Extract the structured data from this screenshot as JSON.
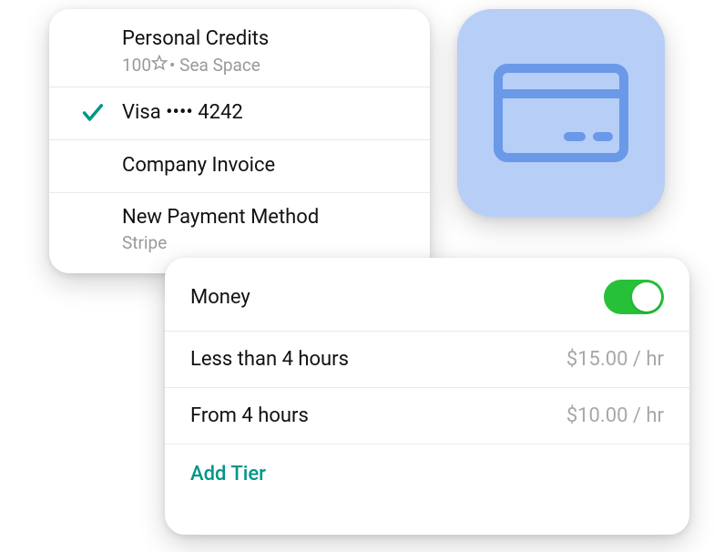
{
  "payments": {
    "items": [
      {
        "title": "Personal Credits",
        "sub_prefix": "100",
        "sub_suffix": " • Sea Space",
        "selected": false
      },
      {
        "title": "Visa •••• 4242",
        "selected": true
      },
      {
        "title": "Company Invoice",
        "selected": false
      },
      {
        "title": "New Payment Method",
        "sub_plain": "Stripe",
        "selected": false
      }
    ]
  },
  "icon_panel": {
    "name": "credit-card-icon"
  },
  "tiers": {
    "header": "Money",
    "toggle_on": true,
    "rows": [
      {
        "label": "Less than 4 hours",
        "price": "$15.00 / hr"
      },
      {
        "label": "From 4 hours",
        "price": "$10.00 / hr"
      }
    ],
    "add_label": "Add Tier"
  }
}
